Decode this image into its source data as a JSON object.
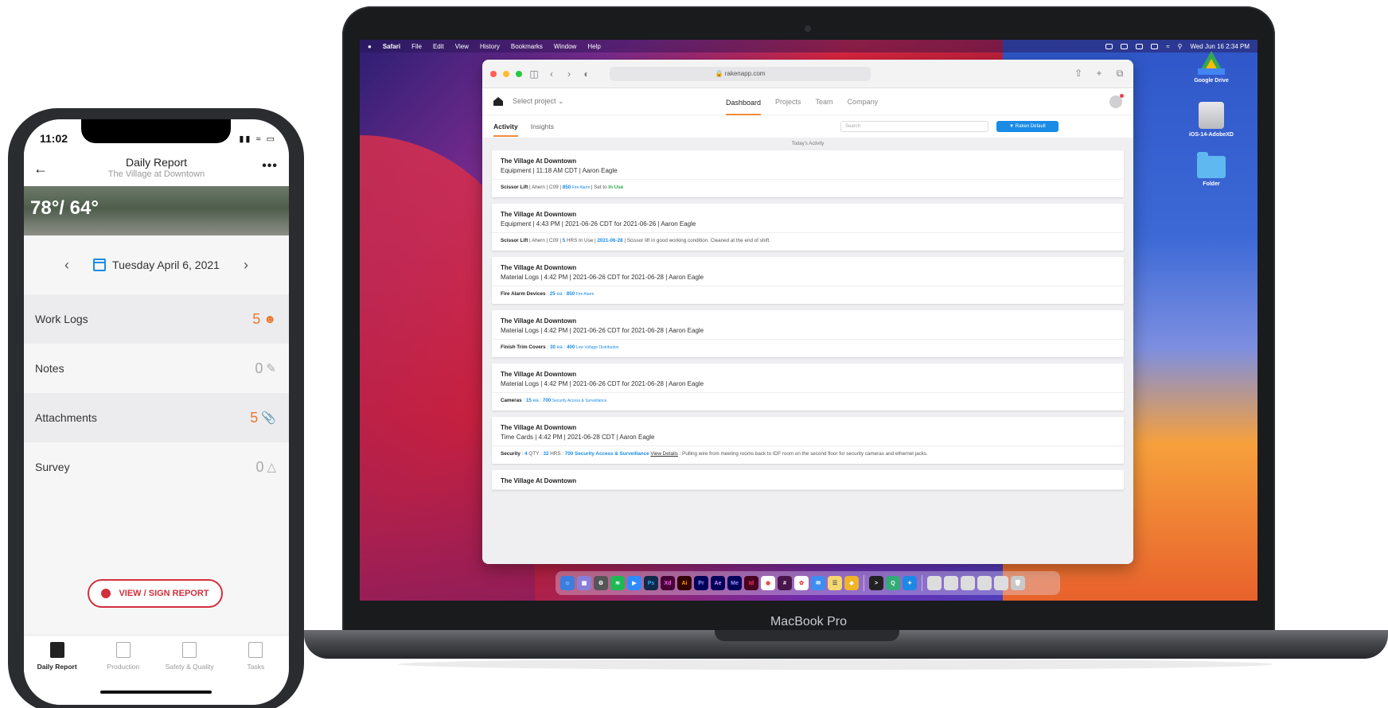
{
  "macbook": {
    "label": "MacBook Pro"
  },
  "menubar": {
    "app": "Safari",
    "items": [
      "File",
      "Edit",
      "View",
      "History",
      "Bookmarks",
      "Window",
      "Help"
    ],
    "clock": "Wed Jun 16 2:34 PM"
  },
  "desktop": {
    "items": [
      "Google Drive",
      "iOS-14-AdobeXD",
      "Folder"
    ]
  },
  "safari": {
    "url": "rakenapp.com"
  },
  "app": {
    "select_project": "Select project",
    "nav": [
      "Dashboard",
      "Projects",
      "Team",
      "Company"
    ],
    "subnav": [
      "Activity",
      "Insights"
    ],
    "search_placeholder": "Search",
    "filter_label": "Raken Default",
    "activity_header": "Today's Activity",
    "cards": [
      {
        "title": "The Village At Downtown",
        "meta": "Equipment | 11:18 AM CDT | Aaron Eagle",
        "item": "Scissor Lift",
        "d1": " | Ahern | C09 | ",
        "code": "850",
        "code_label": " Fire Alarm ",
        "d2": "| Set to ",
        "status": "In Use"
      },
      {
        "title": "The Village At Downtown",
        "meta": "Equipment | 4:43 PM | 2021-06-26 CDT for 2021-06-26 | Aaron Eagle",
        "item": "Scissor Lift",
        "d1": " | Ahern | C09 | ",
        "code": "5",
        "code_label": " HRS In Use | ",
        "d2": "2021-06-28",
        "status": " | Scissor lift in good working condition. Cleaned at the end of shift."
      },
      {
        "title": "The Village At Downtown",
        "meta": "Material Logs | 4:42 PM | 2021-06-26 CDT for 2021-06-28 | Aaron Eagle",
        "item": "Fire Alarm Devices",
        "d1": " : ",
        "code": "25",
        "code_label": " ea : ",
        "d2": "850",
        "status": " Fire Alarm"
      },
      {
        "title": "The Village At Downtown",
        "meta": "Material Logs | 4:42 PM | 2021-06-26 CDT for 2021-06-28 | Aaron Eagle",
        "item": "Finish Trim Covers",
        "d1": " : ",
        "code": "30",
        "code_label": " ea : ",
        "d2": "400",
        "status": " Low Voltage Distribution"
      },
      {
        "title": "The Village At Downtown",
        "meta": "Material Logs | 4:42 PM | 2021-06-26 CDT for 2021-06-28 | Aaron Eagle",
        "item": "Cameras",
        "d1": " : ",
        "code": "15",
        "code_label": " ea : ",
        "d2": "700",
        "status": " Security Access & Surveillance"
      },
      {
        "title": "The Village At Downtown",
        "meta": "Time Cards | 4:42 PM | 2021-06-28 CDT | Aaron Eagle",
        "item": "Security",
        "d1": " : ",
        "code": "4",
        "code_label": " QTY : ",
        "d2": "32",
        "status": " HRS : "
      }
    ],
    "card6_extra": {
      "code": "700 Security Access & Surveillance",
      "link": "View Details",
      "note": " : Pulling wire from meeting rooms back to IDF room on the second floor for security cameras and ethernet jacks."
    },
    "partial_card_title": "The Village At Downtown"
  },
  "phone": {
    "time": "11:02",
    "header_title": "Daily Report",
    "header_subtitle": "The Village at Downtown",
    "weather": "78°/ 64°",
    "date": "Tuesday April 6, 2021",
    "rows": [
      {
        "label": "Work Logs",
        "value": "5",
        "icon": "person-icon"
      },
      {
        "label": "Notes",
        "value": "0",
        "icon": "note-icon"
      },
      {
        "label": "Attachments",
        "value": "5",
        "icon": "paperclip-icon"
      },
      {
        "label": "Survey",
        "value": "0",
        "icon": "warning-cone-icon"
      }
    ],
    "sign_button": "VIEW / SIGN REPORT",
    "tabs": [
      "Daily Report",
      "Production",
      "Safety & Quality",
      "Tasks"
    ]
  },
  "colors": {
    "accent_orange": "#e8782e",
    "accent_blue": "#1a8ce6",
    "danger_red": "#d12f3b"
  }
}
